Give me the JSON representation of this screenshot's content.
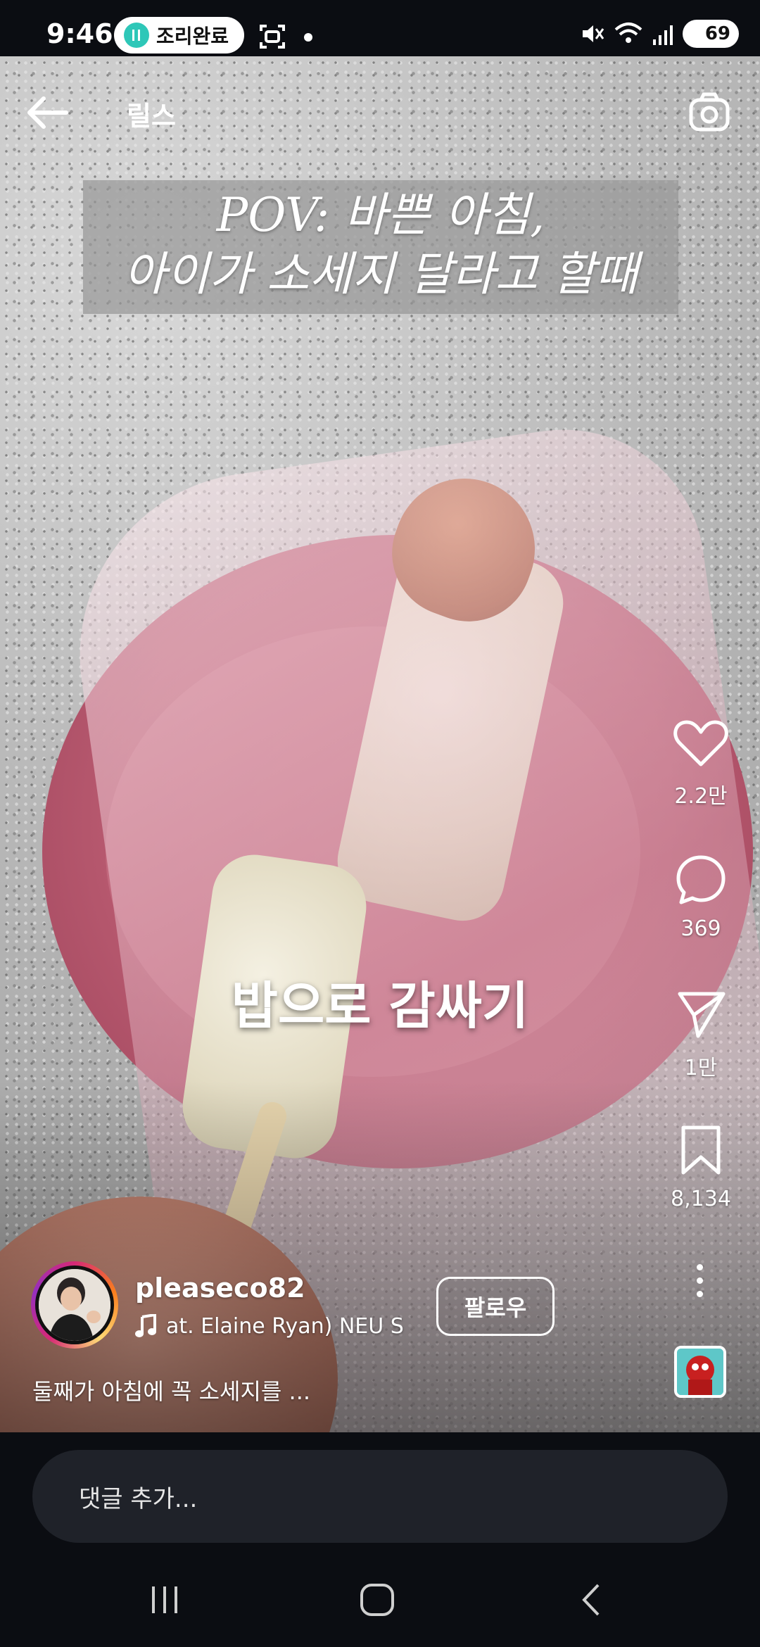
{
  "status_bar": {
    "time": "9:46",
    "cooking_pill": "조리완료",
    "battery": "69"
  },
  "header": {
    "title": "릴스",
    "icons": [
      "back-arrow-icon",
      "camera-icon"
    ]
  },
  "reel": {
    "overlay_caption_line1": "POV: 바쁜 아침,",
    "overlay_caption_line2": "아이가 소세지 달라고 할때",
    "center_caption": "밥으로 감싸기"
  },
  "actions": {
    "like_count": "2.2만",
    "comment_count": "369",
    "share_count": "1만",
    "save_count": "8,134"
  },
  "author": {
    "username": "pleaseco82",
    "music": "at. Elaine Ryan)    NEU S",
    "follow_label": "팔로우",
    "description": "둘째가 아침에 꼭 소세지를 ..."
  },
  "comment": {
    "placeholder": "댓글 추가..."
  },
  "colors": {
    "background": "#0b0d12",
    "comment_field": "#1f2229",
    "plate": "#b95a70",
    "accent_ring": "#d62976"
  }
}
